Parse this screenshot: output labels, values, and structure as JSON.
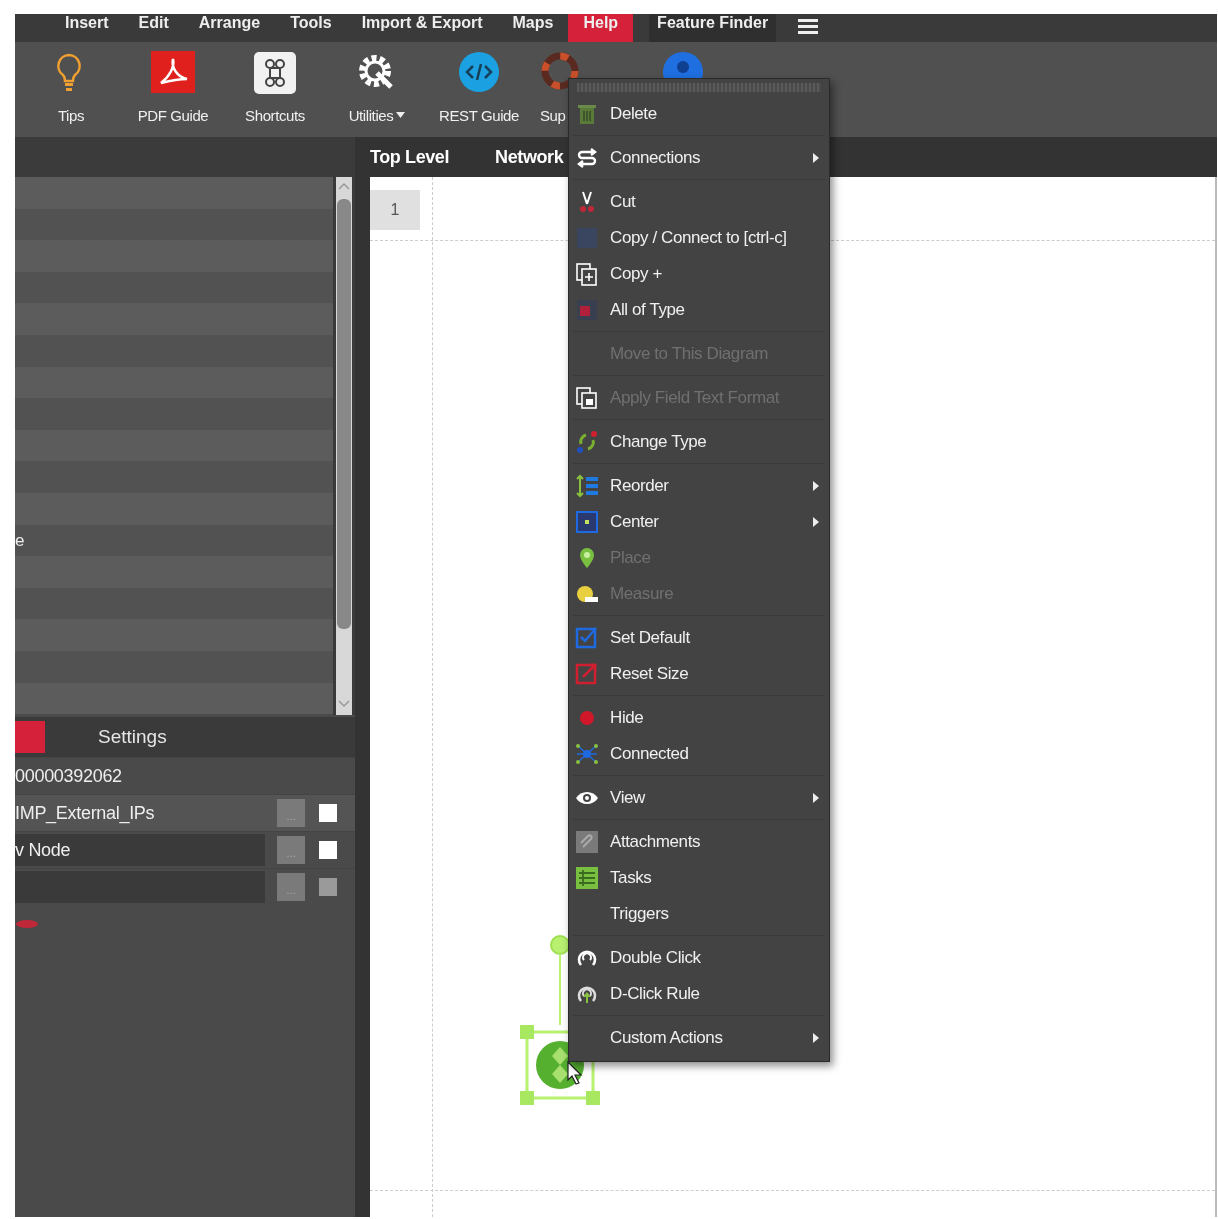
{
  "menu_bar": {
    "items": [
      {
        "label": "Insert",
        "kind": "menu",
        "selected": false
      },
      {
        "label": "Edit",
        "kind": "menu",
        "selected": false
      },
      {
        "label": "Arrange",
        "kind": "menu",
        "selected": false
      },
      {
        "label": "Tools",
        "kind": "menu",
        "selected": false
      },
      {
        "label": "Import & Export",
        "kind": "menu",
        "selected": false
      },
      {
        "label": "Maps",
        "kind": "menu",
        "selected": false
      },
      {
        "label": "Help",
        "kind": "menu",
        "selected": true
      },
      {
        "label": "Feature Finder",
        "kind": "button",
        "selected": false
      }
    ]
  },
  "toolbar": {
    "items": [
      {
        "label": "Tips",
        "dropdown": false
      },
      {
        "label": "PDF Guide",
        "dropdown": false
      },
      {
        "label": "Shortcuts",
        "dropdown": false
      },
      {
        "label": "Utilities",
        "dropdown": true
      },
      {
        "label": "REST Guide",
        "dropdown": false
      },
      {
        "label": "Sup",
        "dropdown": false
      },
      {
        "dropdown": false
      }
    ]
  },
  "diagram_tabs": [
    {
      "label": "Top Level"
    },
    {
      "label": "Network"
    }
  ],
  "side_list": {
    "partial_label": "e"
  },
  "settings": {
    "tabs": [
      {
        "kind": "color",
        "selected": true
      },
      {
        "kind": "text",
        "label": "Settings",
        "selected": false
      }
    ],
    "rows": [
      {
        "kind": "text",
        "value": "00000392062"
      },
      {
        "kind": "readonly",
        "value": "IMP_External_IPs",
        "button": "...",
        "checkbox": {
          "checked": false,
          "disabled": false
        }
      },
      {
        "kind": "input",
        "value": "v Node",
        "button": "...",
        "checkbox": {
          "checked": false,
          "disabled": false
        }
      },
      {
        "kind": "input",
        "button": "...",
        "checkbox": {
          "checked": false,
          "disabled": true
        }
      },
      {
        "kind": "mark"
      }
    ]
  },
  "canvas": {
    "page_label": "1"
  },
  "context_menu": {
    "groups": [
      {
        "items": [
          {
            "label": "Delete",
            "disabled": false,
            "submenu": false
          }
        ]
      },
      {
        "items": [
          {
            "label": "Connections",
            "disabled": false,
            "submenu": true
          }
        ]
      },
      {
        "items": [
          {
            "label": "Cut",
            "disabled": false,
            "submenu": false
          },
          {
            "label": "Copy / Connect to [ctrl-c]",
            "disabled": false,
            "submenu": false
          },
          {
            "label": "Copy +",
            "disabled": false,
            "submenu": false
          },
          {
            "label": "All of Type",
            "disabled": false,
            "submenu": false
          }
        ]
      },
      {
        "items": [
          {
            "label": "Move to This Diagram",
            "disabled": true,
            "submenu": false
          }
        ]
      },
      {
        "items": [
          {
            "label": "Apply Field Text Format",
            "disabled": true,
            "submenu": false
          }
        ]
      },
      {
        "items": [
          {
            "label": "Change Type",
            "disabled": false,
            "submenu": false
          }
        ]
      },
      {
        "items": [
          {
            "label": "Reorder",
            "disabled": false,
            "submenu": true
          },
          {
            "label": "Center",
            "disabled": false,
            "submenu": true
          },
          {
            "label": "Place",
            "disabled": true,
            "submenu": false
          },
          {
            "label": "Measure",
            "disabled": true,
            "submenu": false
          }
        ]
      },
      {
        "items": [
          {
            "label": "Set Default",
            "disabled": false,
            "submenu": false
          },
          {
            "label": "Reset Size",
            "disabled": false,
            "submenu": false
          }
        ]
      },
      {
        "items": [
          {
            "label": "Hide",
            "disabled": false,
            "submenu": false
          },
          {
            "label": "Connected",
            "disabled": false,
            "submenu": false
          }
        ]
      },
      {
        "items": [
          {
            "label": "View",
            "disabled": false,
            "submenu": true
          }
        ]
      },
      {
        "items": [
          {
            "label": "Attachments",
            "disabled": false,
            "submenu": false
          },
          {
            "label": "Tasks",
            "disabled": false,
            "submenu": false
          },
          {
            "label": "Triggers",
            "disabled": false,
            "submenu": false
          }
        ]
      },
      {
        "items": [
          {
            "label": "Double Click",
            "disabled": false,
            "submenu": false
          },
          {
            "label": "D-Click Rule",
            "disabled": false,
            "submenu": false
          }
        ]
      },
      {
        "items": [
          {
            "label": "Custom Actions",
            "disabled": false,
            "submenu": true
          }
        ]
      }
    ]
  }
}
